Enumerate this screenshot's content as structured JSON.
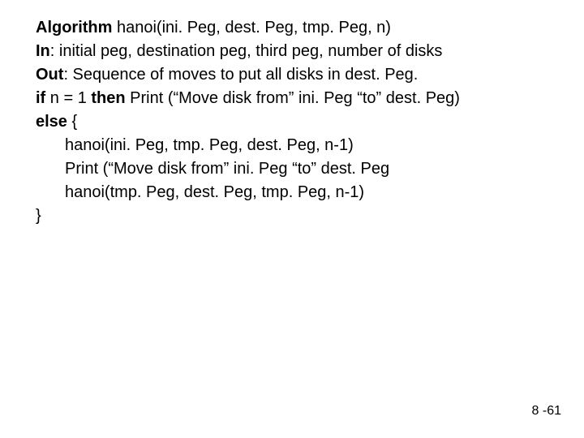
{
  "algo": {
    "kw_algorithm": "Algorithm",
    "sig": " hanoi(ini. Peg, dest. Peg, tmp. Peg, n)",
    "kw_in": "In",
    "in_rest": ": initial peg, destination peg, third peg, number of disks",
    "kw_out": "Out",
    "out_rest": ": Sequence of moves to put all disks in dest. Peg.",
    "kw_if": "if",
    "if_cond": " n = 1 ",
    "kw_then": "then",
    "then_rest": " Print (“Move disk from” ini. Peg “to” dest. Peg)",
    "kw_else": "else",
    "else_rest": " {",
    "body1": "hanoi(ini. Peg, tmp. Peg, dest. Peg, n-1)",
    "body2": "Print (“Move disk from” ini. Peg “to” dest. Peg",
    "body3": "hanoi(tmp. Peg, dest. Peg, tmp. Peg, n-1)",
    "close": "}"
  },
  "page_number": "8 -61"
}
